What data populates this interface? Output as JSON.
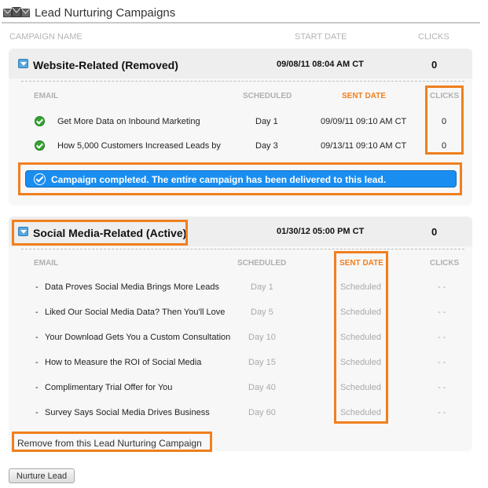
{
  "header": {
    "title": "Lead Nurturing Campaigns",
    "icon": "envelopes-icon"
  },
  "columns": {
    "name": "CAMPAIGN NAME",
    "start": "START DATE",
    "clicks": "CLICKS"
  },
  "campaigns": [
    {
      "name": "Website-Related (Removed)",
      "start_date": "09/08/11 08:04 AM CT",
      "clicks": "0",
      "sub_headers": {
        "email": "EMAIL",
        "scheduled": "SCHEDULED",
        "sent": "SENT DATE",
        "clicks": "CLICKS"
      },
      "emails": [
        {
          "name": "Get More Data on Inbound Marketing",
          "scheduled": "Day 1",
          "sent": "09/09/11 09:10 AM CT",
          "clicks": "0"
        },
        {
          "name": "How 5,000 Customers Increased Leads by",
          "scheduled": "Day 3",
          "sent": "09/13/11 09:10 AM CT",
          "clicks": "0"
        }
      ],
      "banner": "Campaign completed. The entire campaign has been delivered to this lead."
    },
    {
      "name": "Social Media-Related (Active)",
      "start_date": "01/30/12 05:00 PM CT",
      "clicks": "0",
      "sub_headers": {
        "email": "EMAIL",
        "scheduled": "SCHEDULED",
        "sent": "SENT DATE",
        "clicks": "CLICKS"
      },
      "emails": [
        {
          "bullet": "-",
          "name": "Data Proves Social Media Brings More Leads",
          "scheduled": "Day 1",
          "sent": "Scheduled",
          "clicks": "- -"
        },
        {
          "bullet": "-",
          "name": "Liked Our Social Media Data? Then You'll Love",
          "scheduled": "Day 5",
          "sent": "Scheduled",
          "clicks": "- -"
        },
        {
          "bullet": "-",
          "name": "Your Download Gets You a Custom Consultation",
          "scheduled": "Day 10",
          "sent": "Scheduled",
          "clicks": "- -"
        },
        {
          "bullet": "-",
          "name": "How to Measure the ROI of Social Media",
          "scheduled": "Day 15",
          "sent": "Scheduled",
          "clicks": "- -"
        },
        {
          "bullet": "-",
          "name": "Complimentary Trial Offer for You",
          "scheduled": "Day 40",
          "sent": "Scheduled",
          "clicks": "- -"
        },
        {
          "bullet": "-",
          "name": "Survey Says Social Media Drives Business",
          "scheduled": "Day 60",
          "sent": "Scheduled",
          "clicks": "- -"
        }
      ],
      "remove_link": "Remove from this Lead Nurturing Campaign"
    }
  ],
  "buttons": {
    "nurture": "Nurture Lead"
  },
  "colors": {
    "highlight": "#f07f1e",
    "banner": "#1a8ef0",
    "check": "#33a531"
  }
}
